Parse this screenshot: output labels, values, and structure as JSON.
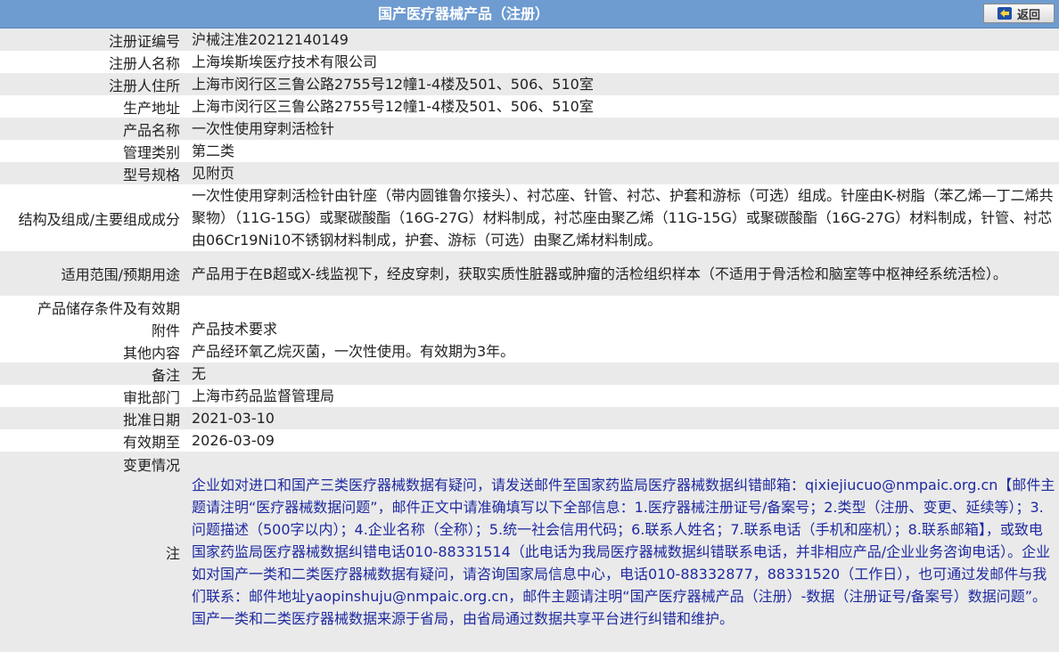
{
  "header": {
    "title": "国产医疗器械产品（注册）",
    "back_label": "返回",
    "back_icon": "back-arrow-icon"
  },
  "fields": [
    {
      "label": "注册证编号",
      "value": "沪械注准20212140149"
    },
    {
      "label": "注册人名称",
      "value": "上海埃斯埃医疗技术有限公司"
    },
    {
      "label": "注册人住所",
      "value": "上海市闵行区三鲁公路2755号12幢1-4楼及501、506、510室"
    },
    {
      "label": "生产地址",
      "value": "上海市闵行区三鲁公路2755号12幢1-4楼及501、506、510室"
    },
    {
      "label": "产品名称",
      "value": "一次性使用穿刺活检针"
    },
    {
      "label": "管理类别",
      "value": "第二类"
    },
    {
      "label": "型号规格",
      "value": "见附页"
    },
    {
      "label": "结构及组成/主要组成成分",
      "value": "一次性使用穿刺活检针由针座（带内圆锥鲁尔接头）、衬芯座、针管、衬芯、护套和游标（可选）组成。针座由K-树脂（苯乙烯—丁二烯共聚物）（11G-15G）或聚碳酸酯（16G-27G）材料制成，衬芯座由聚乙烯（11G-15G）或聚碳酸酯（16G-27G）材料制成，针管、衬芯由06Cr19Ni10不锈钢材料制成，护套、游标（可选）由聚乙烯材料制成。"
    },
    {
      "label": "适用范围/预期用途",
      "value": "产品用于在B超或X-线监视下，经皮穿刺，获取实质性脏器或肿瘤的活检组织样本（不适用于骨活检和脑室等中枢神经系统活检）。"
    },
    {
      "label": "产品储存条件及有效期",
      "value": ""
    },
    {
      "label": "附件",
      "value": "产品技术要求"
    },
    {
      "label": "其他内容",
      "value": "产品经环氧乙烷灭菌，一次性使用。有效期为3年。"
    },
    {
      "label": "备注",
      "value": "无"
    },
    {
      "label": "审批部门",
      "value": "上海市药品监督管理局"
    },
    {
      "label": "批准日期",
      "value": "2021-03-10"
    },
    {
      "label": "有效期至",
      "value": "2026-03-09"
    },
    {
      "label": "变更情况",
      "value": ""
    }
  ],
  "notes": {
    "label": "注",
    "text": "企业如对进口和国产三类医疗器械数据有疑问，请发送邮件至国家药监局医疗器械数据纠错邮箱：qixiejiucuo@nmpaic.org.cn【邮件主题请注明“医疗器械数据问题”，邮件正文中请准确填写以下全部信息：1.医疗器械注册证号/备案号；2.类型（注册、变更、延续等）；3.问题描述（500字以内）；4.企业名称（全称）；5.统一社会信用代码；6.联系人姓名；7.联系电话（手机和座机）；8.联系邮箱】，或致电国家药监局医疗器械数据纠错电话010-88331514（此电话为我局医疗器械数据纠错联系电话，并非相应产品/企业业务咨询电话）。企业如对国产一类和二类医疗器械数据有疑问，请咨询国家局信息中心，电话010-88332877，88331520（工作日），也可通过发邮件与我们联系：邮件地址yaopinshuju@nmpaic.org.cn，邮件主题请注明“国产医疗器械产品（注册）-数据（注册证号/备案号）数据问题”。国产一类和二类医疗器械数据来源于省局，由省局通过数据共享平台进行纠错和维护。"
  },
  "colors": {
    "header_bg": "#6e9bd0",
    "row_alt": "#eaeaea",
    "notes_text": "#1f2aa0"
  }
}
